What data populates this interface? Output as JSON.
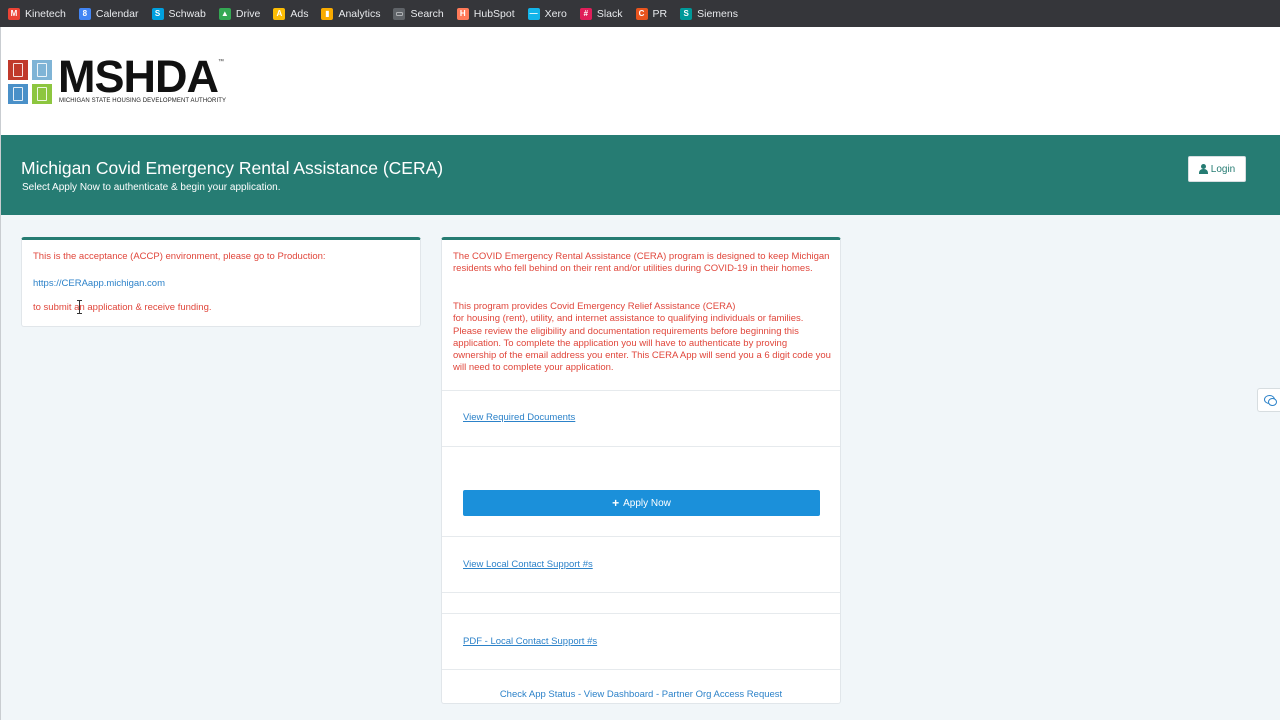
{
  "bookmarks": [
    {
      "label": "Kinetech",
      "icon": "gmail-icon",
      "color": "#ea4335",
      "glyph": "M"
    },
    {
      "label": "Calendar",
      "icon": "calendar-icon",
      "color": "#4285f4",
      "glyph": "8"
    },
    {
      "label": "Schwab",
      "icon": "schwab-icon",
      "color": "#00a0df",
      "glyph": "S"
    },
    {
      "label": "Drive",
      "icon": "drive-icon",
      "color": "#34a853",
      "glyph": "▲"
    },
    {
      "label": "Ads",
      "icon": "ads-icon",
      "color": "#fbbc04",
      "glyph": "A"
    },
    {
      "label": "Analytics",
      "icon": "analytics-icon",
      "color": "#f9ab00",
      "glyph": "▮"
    },
    {
      "label": "Search",
      "icon": "search-console-icon",
      "color": "#5f6368",
      "glyph": "▭"
    },
    {
      "label": "HubSpot",
      "icon": "hubspot-icon",
      "color": "#ff7a59",
      "glyph": "H"
    },
    {
      "label": "Xero",
      "icon": "xero-icon",
      "color": "#13b5ea",
      "glyph": "—"
    },
    {
      "label": "Slack",
      "icon": "slack-icon",
      "color": "#e01e5a",
      "glyph": "#"
    },
    {
      "label": "PR",
      "icon": "pr-icon",
      "color": "#e8541e",
      "glyph": "C"
    },
    {
      "label": "Siemens",
      "icon": "siemens-icon",
      "color": "#009999",
      "glyph": "S"
    }
  ],
  "logo": {
    "wordmark": "MSHDA",
    "trademark": "™",
    "subtitle": "MICHIGAN STATE HOUSING DEVELOPMENT AUTHORITY"
  },
  "banner": {
    "title": "Michigan Covid Emergency Rental Assistance (CERA)",
    "subtitle": "Select Apply Now to authenticate & begin your application.",
    "login_label": "Login"
  },
  "notice": {
    "line1": "This is the acceptance (ACCP) environment, please go to Production:",
    "link": "https://CERAapp.michigan.com",
    "line3": "to submit an application & receive funding."
  },
  "program": {
    "para1": "The COVID Emergency Rental Assistance (CERA) program is designed to keep Michigan residents who fell behind on their rent and/or utilities during COVID-19 in their homes.",
    "para2_line1": "This program provides Covid Emergency Relief Assistance (CERA)",
    "para2_rest": "for housing (rent), utility, and internet assistance to qualifying individuals or families. Please review the eligibility and documentation requirements before beginning this application. To complete the application you will have to authenticate by proving ownership of the email address you enter. This CERA App will send you a 6 digit code you will need to complete your application.",
    "required_docs_link": "View Required Documents",
    "apply_label": "Apply Now",
    "local_support_link": "View Local Contact Support #s",
    "pdf_support_link": "PDF - Local Contact Support #s",
    "footer": {
      "check_status": "Check App Status",
      "sep1": " - ",
      "dashboard": "View Dashboard",
      "sep2": " - ",
      "partner": "Partner Org Access Request"
    }
  },
  "colors": {
    "banner": "#267c73",
    "error_text": "#e0463b",
    "link": "#2c82c9",
    "apply_button": "#1b90da"
  }
}
